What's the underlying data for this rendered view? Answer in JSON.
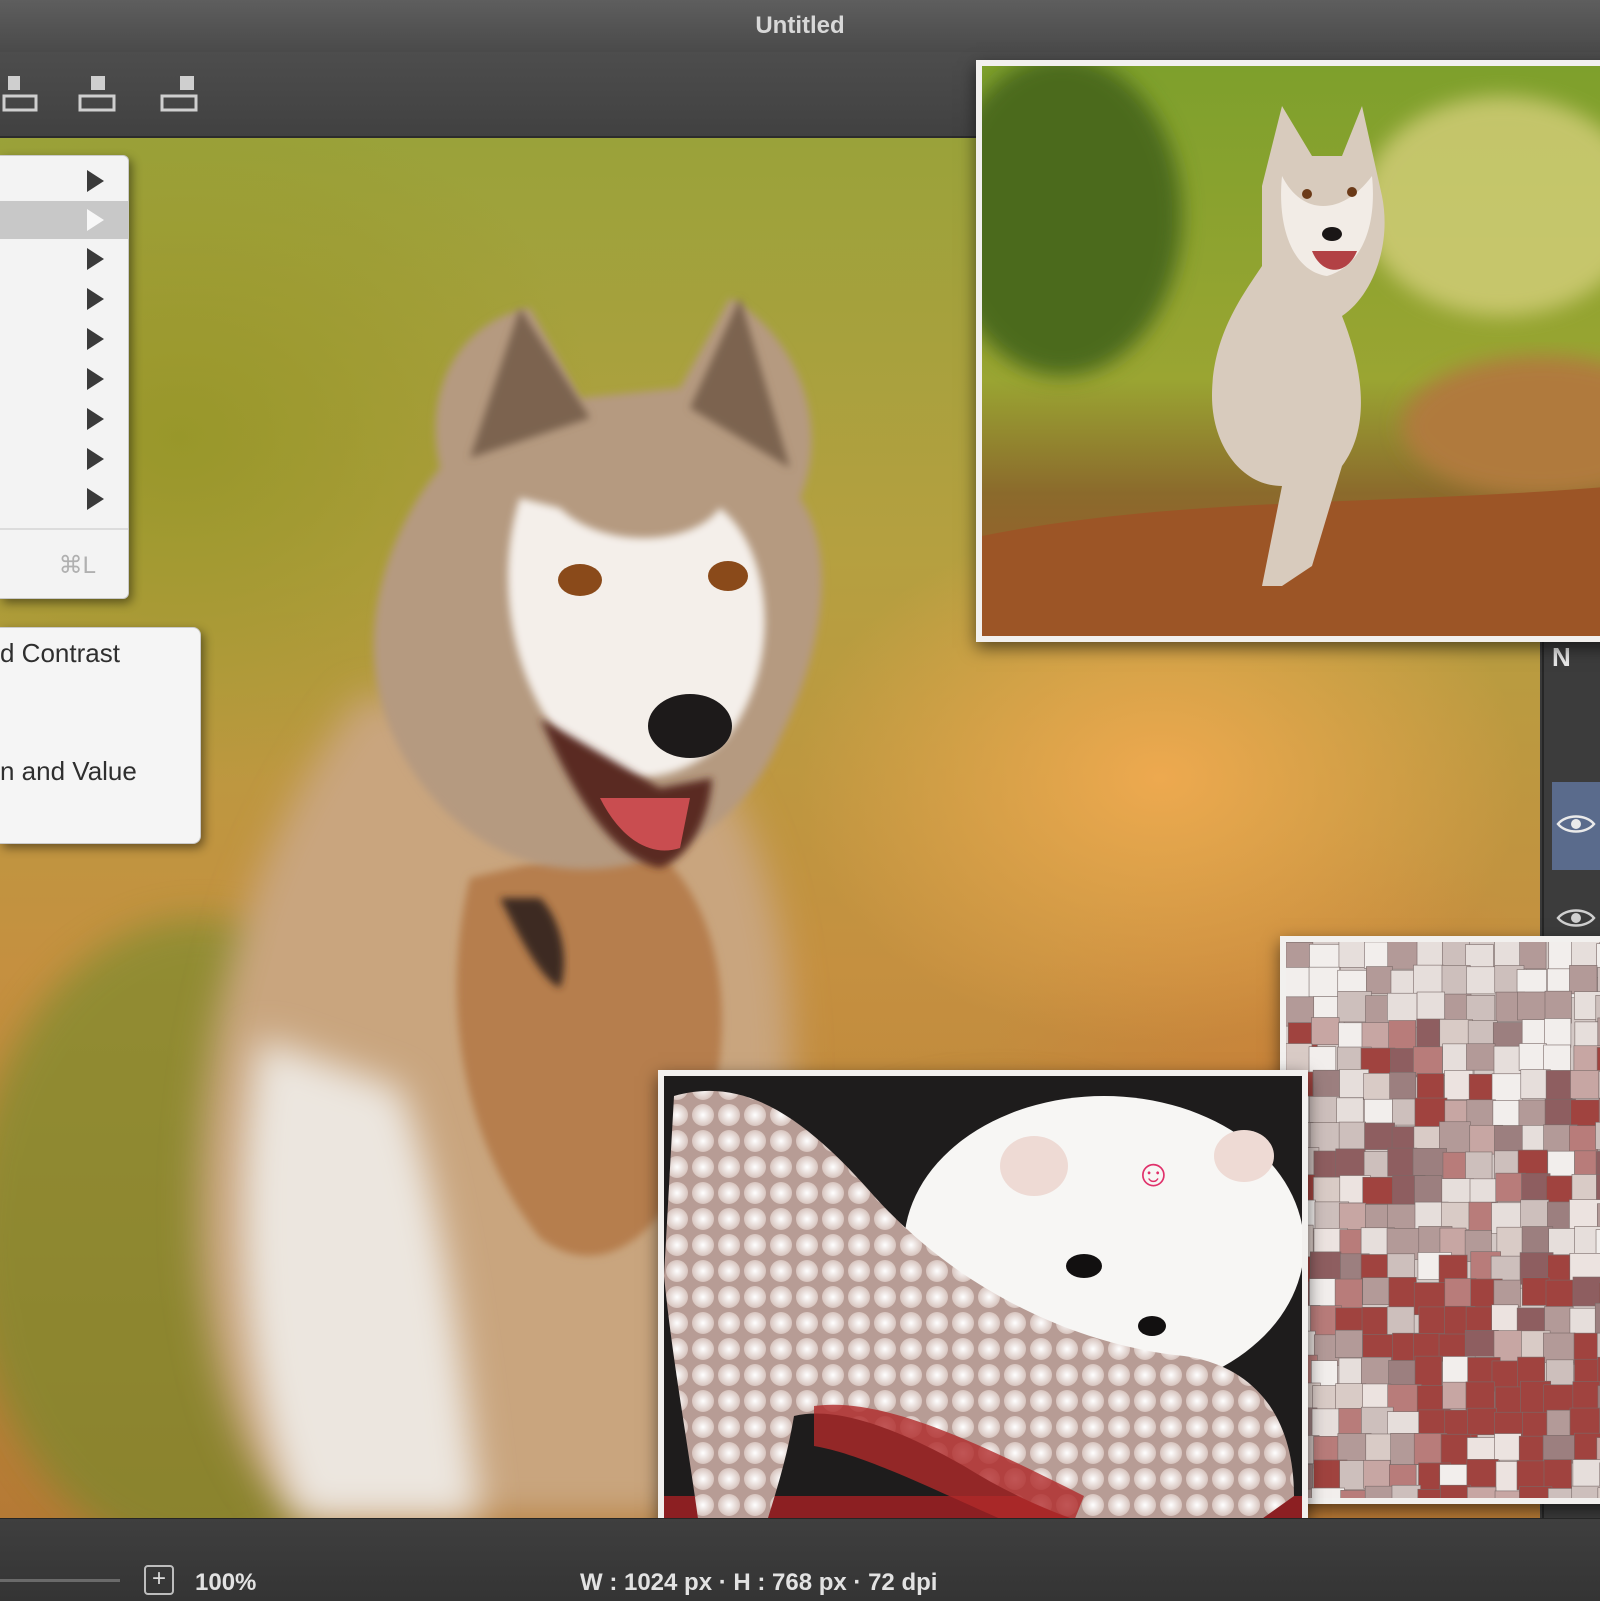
{
  "window": {
    "title": "Untitled"
  },
  "toolbar": {
    "buttons": [
      {
        "name": "align-bottom-left-icon"
      },
      {
        "name": "align-bottom-center-icon"
      },
      {
        "name": "align-bottom-right-icon"
      }
    ]
  },
  "menu_primary": {
    "highlighted_index": 1,
    "submenu_rows": 9,
    "shortcut": "⌘L"
  },
  "menu_adjustments": {
    "items": [
      "d Contrast",
      "n and Value"
    ]
  },
  "canvas": {
    "image": "husky portrait (blurred)"
  },
  "photos": [
    {
      "name": "running-husky-photo"
    },
    {
      "name": "puppy-with-pearl-shoe-photo"
    },
    {
      "name": "mosaic-filter-photo"
    }
  ],
  "right_panel": {
    "header_glyph": "N"
  },
  "status": {
    "zoom": "100%",
    "dimensions": "W : 1024 px  ·  H : 768 px  ·  72 dpi"
  },
  "colors": {
    "chrome_dark": "#3a3a3a",
    "menu_bg": "#f3f3f3",
    "selection_blue": "#5a6b8c"
  }
}
